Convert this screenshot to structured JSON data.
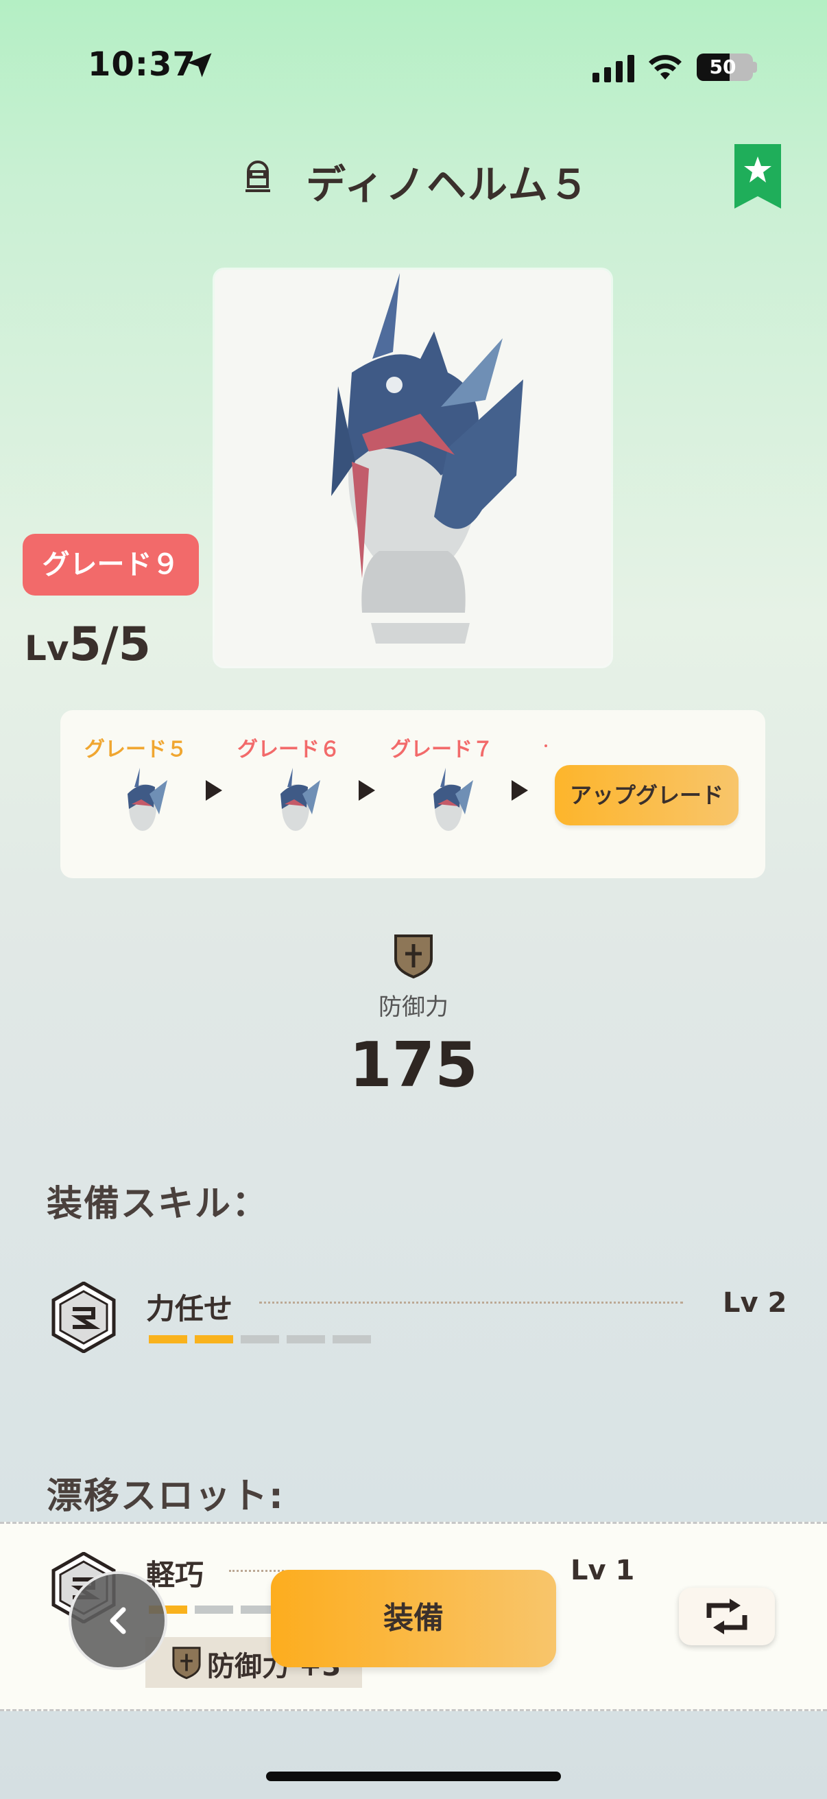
{
  "status_bar": {
    "time": "10:37",
    "battery": "50"
  },
  "header": {
    "title": "ディノヘルム５"
  },
  "item": {
    "grade": "グレード９",
    "lv_prefix": "Lv",
    "level": "5/5"
  },
  "upgrade": {
    "steps": [
      "グレード５",
      "グレード６",
      "グレード７"
    ],
    "button_label": "アップグレード"
  },
  "stats": {
    "defense_label": "防御力",
    "defense_value": "175"
  },
  "skills": {
    "title": "装備スキル：",
    "items": [
      {
        "name": "力任せ",
        "level": "Lv 2",
        "filled": 2,
        "total": 5
      }
    ]
  },
  "drift_slots": {
    "title": "漂移スロット:",
    "items": [
      {
        "name": "軽巧",
        "level": "Lv 1",
        "filled": 1,
        "total": 5,
        "bonus": "防御力 +3"
      }
    ]
  },
  "actions": {
    "equip_label": "装備"
  },
  "colors": {
    "grade_red": "#f26a6a",
    "grade5_orange": "#f0a630",
    "accent_orange": "#fdb52b",
    "bookmark_green": "#1fae5a",
    "segment_filled": "#f9b21d",
    "segment_empty": "#c4c8c8"
  },
  "icons": {
    "location": "location-arrow-icon",
    "signal": "cellular-signal-icon",
    "wifi": "wifi-icon",
    "helm": "helm-icon",
    "bookmark": "bookmark-star-icon",
    "shield": "shield-plus-icon",
    "skill": "hexagon-skill-icon",
    "back": "chevron-left-icon",
    "swap": "swap-arrows-icon"
  }
}
